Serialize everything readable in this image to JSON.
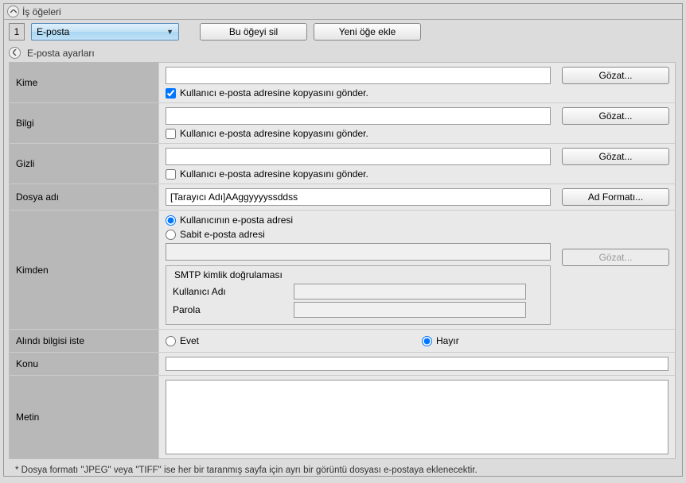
{
  "header": {
    "title": "İş öğeleri"
  },
  "toolbar": {
    "item_number": "1",
    "dropdown_value": "E-posta",
    "delete_label": "Bu öğeyi sil",
    "add_label": "Yeni öğe ekle"
  },
  "sub_header": {
    "title": "E-posta ayarları"
  },
  "rows": {
    "kime": {
      "label": "Kime",
      "value": "",
      "browse": "Gözat...",
      "checkbox": "Kullanıcı e-posta adresine kopyasını gönder."
    },
    "bilgi": {
      "label": "Bilgi",
      "value": "",
      "browse": "Gözat...",
      "checkbox": "Kullanıcı e-posta adresine kopyasını gönder."
    },
    "gizli": {
      "label": "Gizli",
      "value": "",
      "browse": "Gözat...",
      "checkbox": "Kullanıcı e-posta adresine kopyasını gönder."
    },
    "dosya_adi": {
      "label": "Dosya adı",
      "value": "[Tarayıcı Adı]AAggyyyyssddss",
      "format_btn": "Ad Formatı..."
    },
    "kimden": {
      "label": "Kimden",
      "radio_user": "Kullanıcının e-posta adresi",
      "radio_fixed": "Sabit e-posta adresi",
      "value": "",
      "browse": "Gözat...",
      "smtp_title": "SMTP kimlik doğrulaması",
      "smtp_user_label": "Kullanıcı Adı",
      "smtp_user_value": "",
      "smtp_pass_label": "Parola",
      "smtp_pass_value": ""
    },
    "alindi": {
      "label": "Alındı bilgisi iste",
      "yes": "Evet",
      "no": "Hayır"
    },
    "konu": {
      "label": "Konu",
      "value": ""
    },
    "metin": {
      "label": "Metin",
      "value": ""
    }
  },
  "footnote": "* Dosya formatı \"JPEG\" veya \"TIFF\" ise her bir taranmış sayfa için ayrı bir görüntü dosyası e-postaya eklenecektir."
}
